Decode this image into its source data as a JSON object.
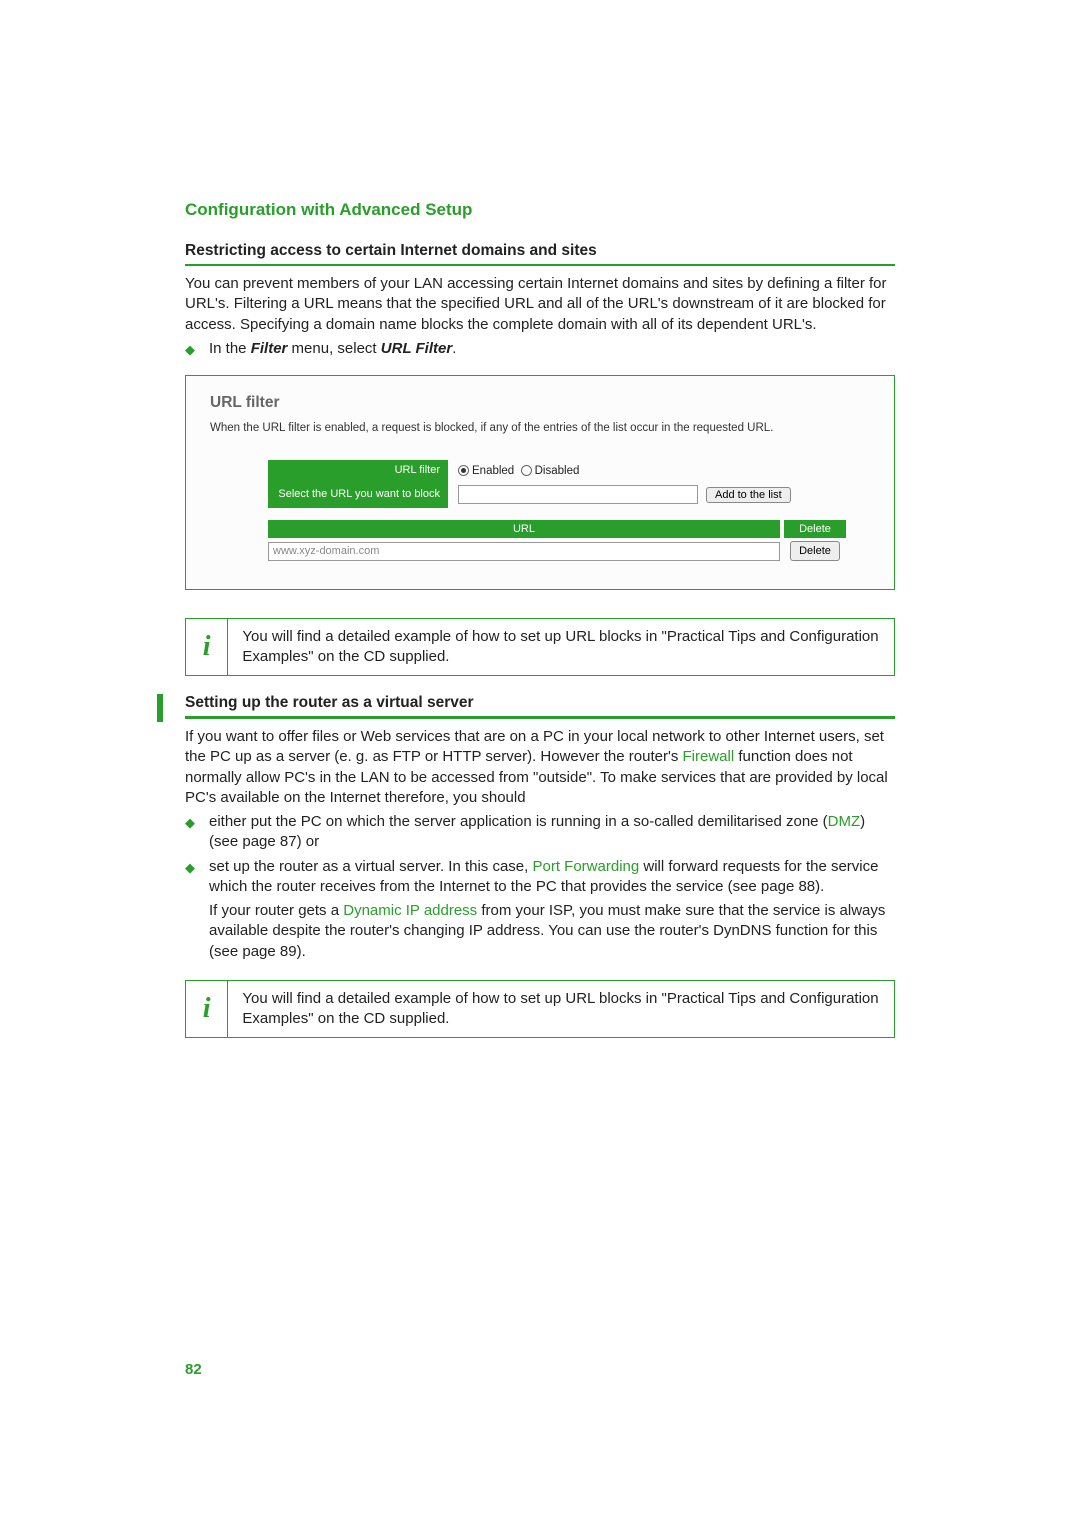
{
  "header": {
    "title": "Configuration with Advanced Setup"
  },
  "section1": {
    "title": "Restricting access to certain Internet domains and sites",
    "para": "You can prevent members of your LAN accessing certain Internet domains and sites by defining a filter for URL's. Filtering a URL means that the specified URL and all of the URL's downstream of it are blocked for access. Specifying a domain name blocks the complete domain with all of its dependent URL's.",
    "bullet_prefix": "In the ",
    "bullet_bold1": "Filter",
    "bullet_mid": " menu, select ",
    "bullet_bold2": "URL Filter",
    "bullet_suffix": "."
  },
  "screenshot": {
    "panel_title": "URL filter",
    "panel_desc": "When the URL filter is enabled, a request is blocked, if any of the entries of the list occur in the requested URL.",
    "row1_label": "URL filter",
    "row1_enabled": "Enabled",
    "row1_disabled": "Disabled",
    "row2_label": "Select the URL you want to block",
    "row2_button": "Add to the list",
    "table_header_url": "URL",
    "table_header_delete": "Delete",
    "table_value": "www.xyz-domain.com",
    "table_delete_btn": "Delete"
  },
  "info1": {
    "text": "You will find a detailed example of how to set up URL blocks in \"Practical Tips and Configuration Examples\" on the CD supplied."
  },
  "section2": {
    "title": "Setting up the router as a virtual server",
    "para_a": "If you want to offer files or Web services that are on a PC in your local network to other Internet users, set the PC up as a server (e. g. as FTP or HTTP server). However the router's ",
    "para_link1": "Firewall",
    "para_b": " function does not normally allow PC's in the LAN to be accessed from \"outside\". To make services that are provided by local PC's available on the Internet therefore, you should",
    "b1_a": "either put the PC on which the server application is running in a so-called demilitarised zone (",
    "b1_link": "DMZ",
    "b1_b": ") (see page 87) or",
    "b2_a": "set up the router as a virtual server. In this case, ",
    "b2_link": "Port Forwarding",
    "b2_b": " will forward requests for the service which the router receives from the Internet to the PC that provides the service (see page 88).",
    "b2_sub_a": "If your router gets a ",
    "b2_sub_link": "Dynamic IP address",
    "b2_sub_b": " from your ISP, you must make sure that the service is always available despite the router's changing IP address. You can use the router's DynDNS function for this (see page 89)."
  },
  "info2": {
    "text": "You will find a detailed example of how to set up URL blocks in \"Practical Tips and Configuration Examples\" on the CD supplied."
  },
  "page_number": "82"
}
